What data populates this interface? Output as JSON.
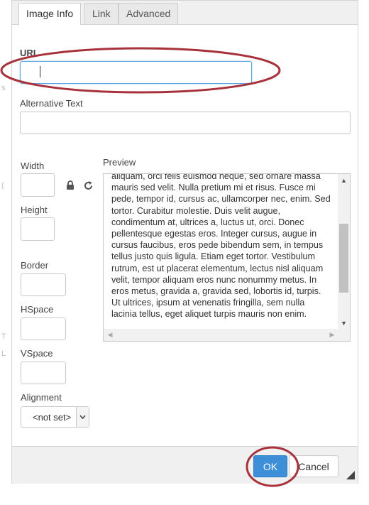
{
  "tabs": [
    {
      "label": "Image Info",
      "active": true
    },
    {
      "label": "Link",
      "active": false
    },
    {
      "label": "Advanced",
      "active": false
    }
  ],
  "form": {
    "url_label": "URL",
    "url_value": "",
    "alt_label": "Alternative Text",
    "alt_value": "",
    "width_label": "Width",
    "height_label": "Height",
    "border_label": "Border",
    "hspace_label": "HSpace",
    "vspace_label": "VSpace",
    "alignment_label": "Alignment",
    "alignment_value": "<not set>"
  },
  "preview": {
    "label": "Preview",
    "text": "aliquam, orci felis euismod neque, sed ornare massa mauris sed velit. Nulla pretium mi et risus. Fusce mi pede, tempor id, cursus ac, ullamcorper nec, enim. Sed tortor. Curabitur molestie. Duis velit augue, condimentum at, ultrices a, luctus ut, orci. Donec pellentesque egestas eros. Integer cursus, augue in cursus faucibus, eros pede bibendum sem, in tempus tellus justo quis ligula. Etiam eget tortor. Vestibulum rutrum, est ut placerat elementum, lectus nisl aliquam velit, tempor aliquam eros nunc nonummy metus. In eros metus, gravida a, gravida sed, lobortis id, turpis. Ut ultrices, ipsum at venenatis fringilla, sem nulla lacinia tellus, eget aliquet turpis mauris non enim."
  },
  "icons": {
    "lock": "lock-icon",
    "reset": "reset-size-icon"
  },
  "footer": {
    "ok_label": "OK",
    "cancel_label": "Cancel"
  },
  "colors": {
    "ok_button": "#3d8fd8",
    "annotation_oval": "#a8323c"
  }
}
